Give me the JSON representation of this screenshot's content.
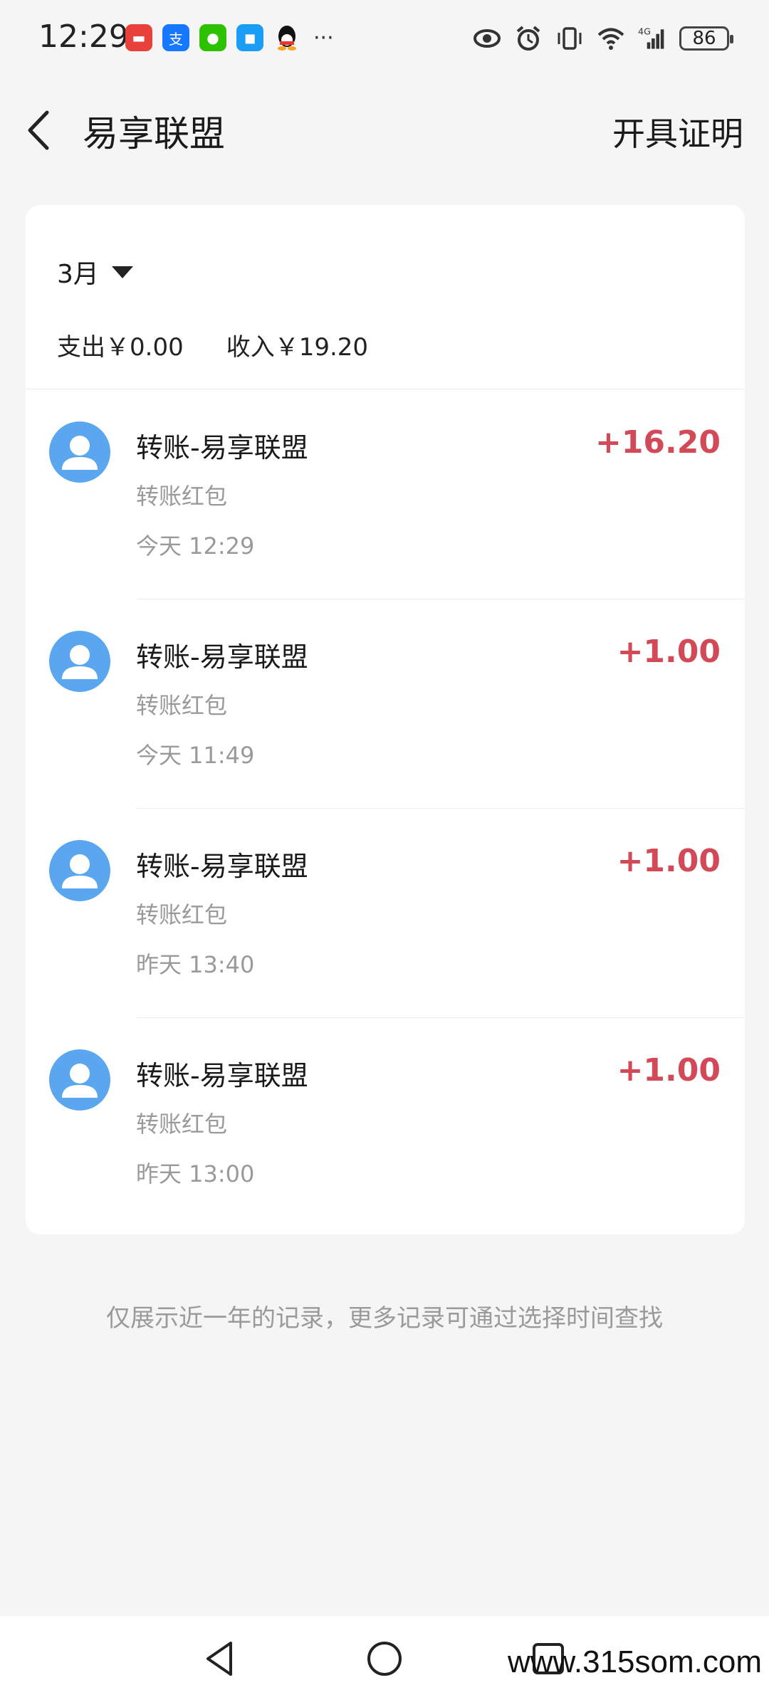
{
  "status_bar": {
    "time": "12:29",
    "battery": "86",
    "network": "4G",
    "more": "···",
    "icons": [
      "huawei-appgallery-icon",
      "alipay-icon",
      "wechat-icon",
      "message-icon",
      "qq-icon",
      "eye-icon",
      "alarm-icon",
      "vibrate-icon",
      "wifi-icon",
      "signal-icon",
      "battery-icon"
    ]
  },
  "header": {
    "title": "易享联盟",
    "action": "开具证明"
  },
  "filter": {
    "month": "3月"
  },
  "summary": {
    "expense": "支出￥0.00",
    "income": "收入￥19.20"
  },
  "transactions": [
    {
      "name": "转账-易享联盟",
      "type": "转账红包",
      "time": "今天 12:29",
      "amount": "+16.20"
    },
    {
      "name": "转账-易享联盟",
      "type": "转账红包",
      "time": "今天 11:49",
      "amount": "+1.00"
    },
    {
      "name": "转账-易享联盟",
      "type": "转账红包",
      "time": "昨天 13:40",
      "amount": "+1.00"
    },
    {
      "name": "转账-易享联盟",
      "type": "转账红包",
      "time": "昨天 13:00",
      "amount": "+1.00"
    }
  ],
  "footer_note": "仅展示近一年的记录，更多记录可通过选择时间查找",
  "watermark": "www.315som.com",
  "colors": {
    "amount": "#d24a57",
    "avatar": "#5aa7f0",
    "background": "#f5f5f5"
  }
}
